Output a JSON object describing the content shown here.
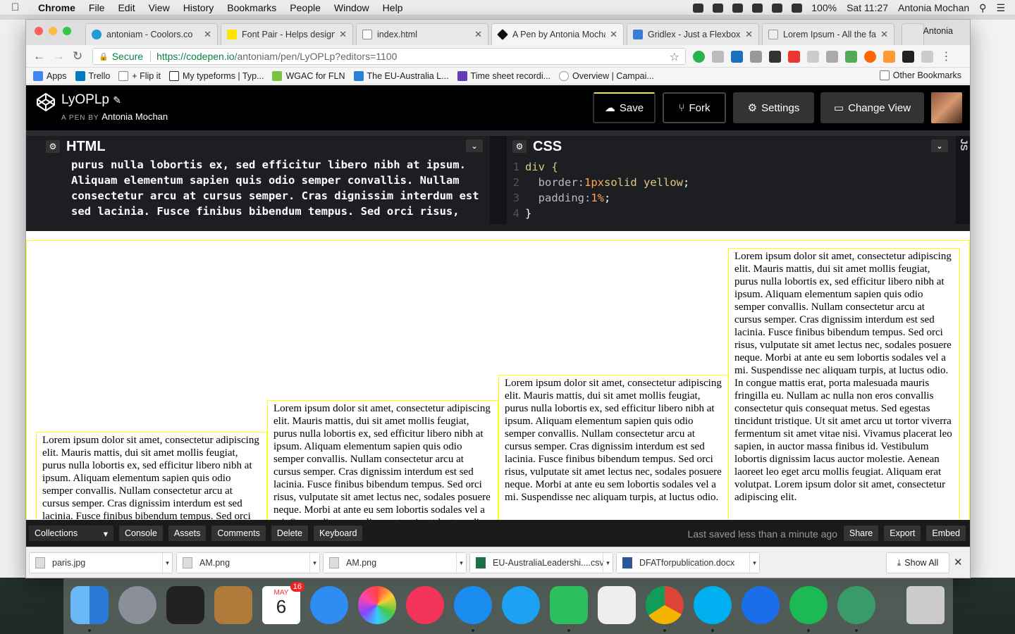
{
  "menubar": {
    "app": "Chrome",
    "items": [
      "File",
      "Edit",
      "View",
      "History",
      "Bookmarks",
      "People",
      "Window",
      "Help"
    ],
    "battery": "100%",
    "clock": "Sat 11:27",
    "user": "Antonia Mochan"
  },
  "tabs": [
    {
      "title": "antoniam - Coolors.co",
      "color": "#1e9cd7"
    },
    {
      "title": "Font Pair - Helps design",
      "color": "#ffe400"
    },
    {
      "title": "index.html",
      "color": "#dddddd"
    },
    {
      "title": "A Pen by Antonia Mochan",
      "color": "#111111"
    },
    {
      "title": "Gridlex - Just a Flexbox",
      "color": "#3a7bd5"
    },
    {
      "title": "Lorem Ipsum - All the fac",
      "color": "#eeeeee"
    }
  ],
  "profile": "Antonia",
  "address": {
    "secure": "Secure",
    "url_host": "https://codepen.io",
    "url_path": "/antoniam/pen/LyOPLp?editors=1100"
  },
  "bookmarks": [
    {
      "label": "Apps",
      "color": "#4285f4"
    },
    {
      "label": "Trello",
      "color": "#0079bf"
    },
    {
      "label": "+ Flip it",
      "color": "#ffffff"
    },
    {
      "label": "My typeforms | Typ...",
      "color": "#262627"
    },
    {
      "label": "WGAC for FLN",
      "color": "#7cc242"
    },
    {
      "label": "The EU-Australia L...",
      "color": "#2c7fd4"
    },
    {
      "label": "Time sheet recordi...",
      "color": "#673ab7"
    },
    {
      "label": "Overview | Campai...",
      "color": "#ffffff"
    }
  ],
  "other_bookmarks": "Other Bookmarks",
  "pen": {
    "title": "LyOPLp",
    "by_prefix": "A PEN BY",
    "author": "Antonia Mochan",
    "buttons": {
      "save": "Save",
      "fork": "Fork",
      "settings": "Settings",
      "change_view": "Change View"
    }
  },
  "editors": {
    "html_label": "HTML",
    "css_label": "CSS",
    "js_tab": "JS",
    "html_code": "purus nulla lobortis ex, sed efficitur libero nibh at ipsum.\nAliquam elementum sapien quis odio semper convallis. Nullam\nconsectetur arcu at cursus semper. Cras dignissim interdum est\nsed lacinia. Fusce finibus bibendum tempus. Sed orci risus,",
    "css_lines": [
      {
        "n": "1",
        "sel": "div {"
      },
      {
        "n": "2",
        "prop": "border: ",
        "val1": "1px",
        "val2": " solid yellow",
        "end": ";"
      },
      {
        "n": "3",
        "prop": "padding: ",
        "val1": "1%",
        "val2": "",
        "end": ";"
      },
      {
        "n": "4",
        "sel": "}"
      }
    ]
  },
  "preview": {
    "lorem": "Lorem ipsum dolor sit amet, consectetur adipiscing elit. Mauris mattis, dui sit amet mollis feugiat, purus nulla lobortis ex, sed efficitur libero nibh at ipsum. Aliquam elementum sapien quis odio semper convallis. Nullam consectetur arcu at cursus semper. Cras dignissim interdum est sed lacinia. Fusce finibus bibendum tempus. Sed orci risus, vulputate sit amet lectus nec, sodales posuere neque. Morbi at ante eu sem lobortis sodales vel a mi. Suspendisse nec aliquam turpis, at luctus odio.",
    "lorem_long": "Lorem ipsum dolor sit amet, consectetur adipiscing elit. Mauris mattis, dui sit amet mollis feugiat, purus nulla lobortis ex, sed efficitur libero nibh at ipsum. Aliquam elementum sapien quis odio semper convallis. Nullam consectetur arcu at cursus semper. Cras dignissim interdum est sed lacinia. Fusce finibus bibendum tempus. Sed orci risus, vulputate sit amet lectus nec, sodales posuere neque. Morbi at ante eu sem lobortis sodales vel a mi. Suspendisse nec aliquam turpis, at luctus odio. In congue mattis erat, porta malesuada mauris fringilla eu. Nullam ac nulla non eros convallis consectetur quis consequat metus. Sed egestas tincidunt tristique. Ut sit amet arcu ut tortor viverra fermentum sit amet vitae nisi. Vivamus placerat leo sapien, in auctor massa finibus id. Vestibulum lobortis dignissim lacus auctor molestie. Aenean laoreet leo eget arcu mollis feugiat. Aliquam erat volutpat. Lorem ipsum dolor sit amet, consectetur adipiscing elit."
  },
  "footer": {
    "collections": "Collections",
    "console": "Console",
    "assets": "Assets",
    "comments": "Comments",
    "delete": "Delete",
    "keyboard": "Keyboard",
    "saved": "Last saved less than a minute ago",
    "share": "Share",
    "export": "Export",
    "embed": "Embed"
  },
  "downloads": {
    "items": [
      "paris.jpg",
      "AM.png",
      "AM.png",
      "EU-AustraliaLeadershi....csv",
      "DFATforpublication.docx"
    ],
    "show_all": "Show All"
  },
  "dock": {
    "calendar_month": "MAY",
    "calendar_day": "6",
    "calendar_badge": "16"
  },
  "colors": {
    "accent_yellow": "#ffff00",
    "codepen_bg": "#000000",
    "secure_green": "#0b8043"
  }
}
